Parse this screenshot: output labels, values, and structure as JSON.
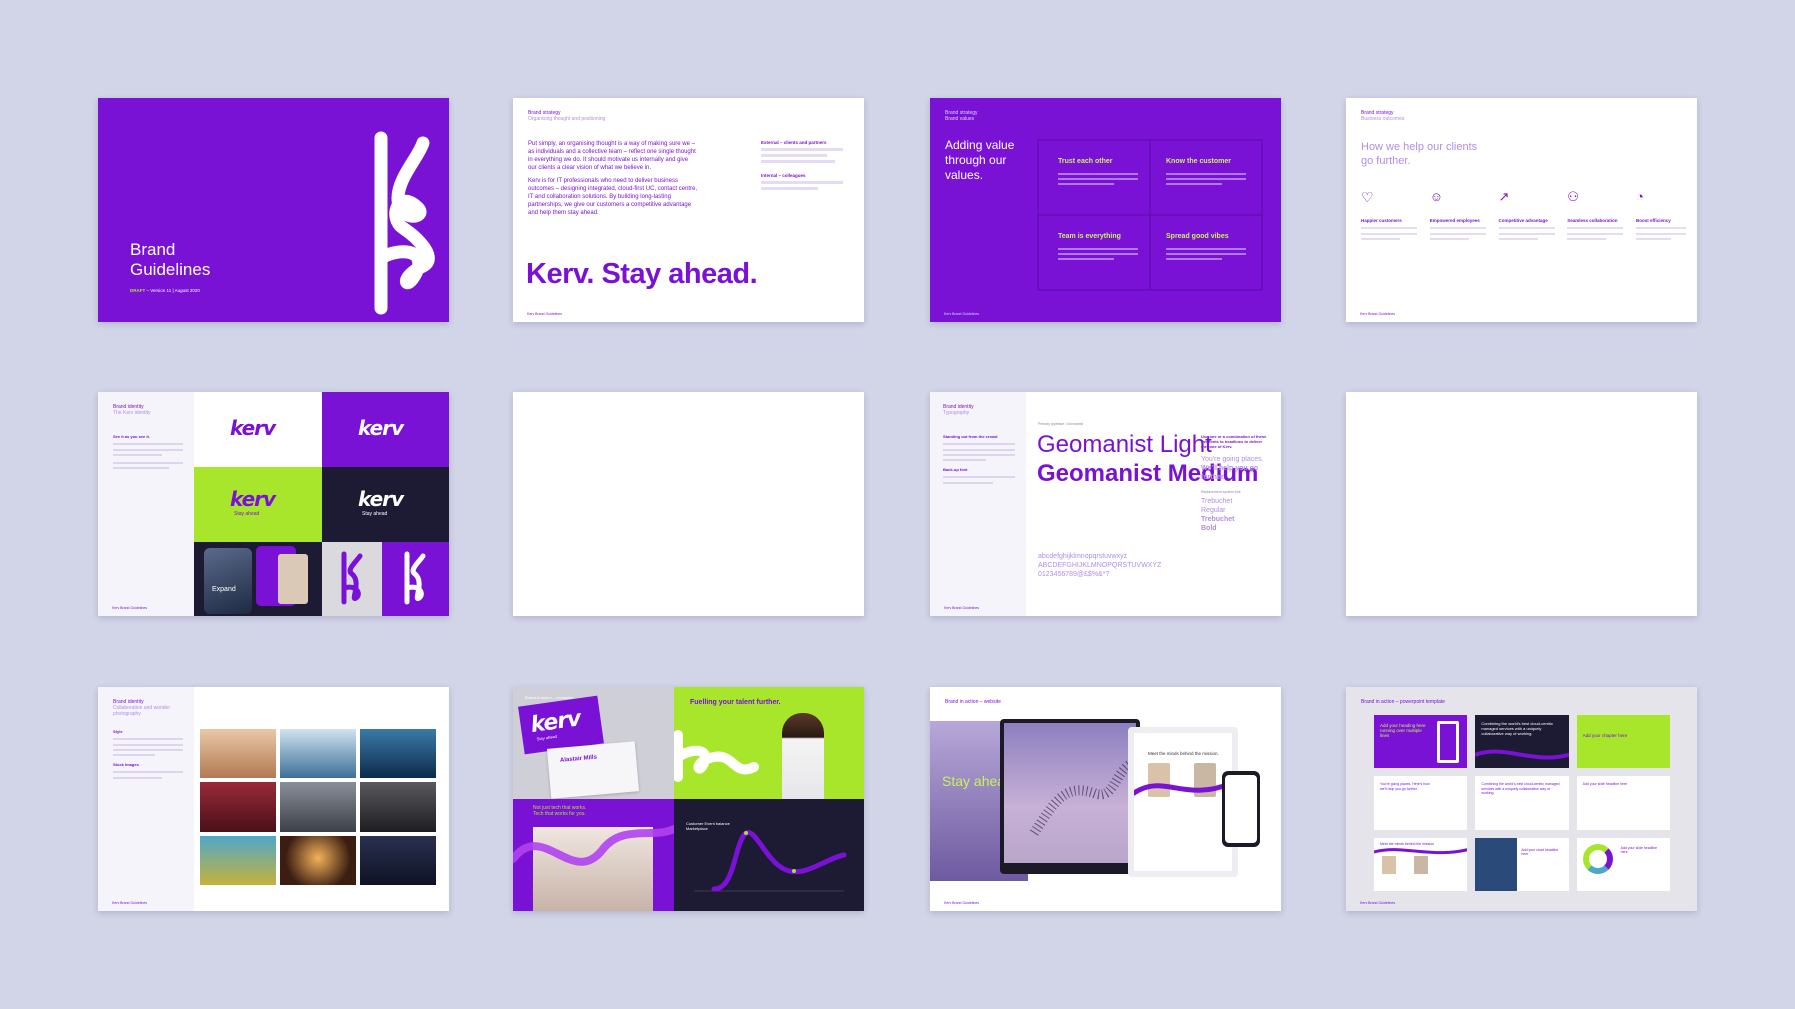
{
  "slides": {
    "cover": {
      "title_line1": "Brand",
      "title_line2": "Guidelines",
      "draft_label": "DRAFT",
      "meta": "– Version 11 | August 2020",
      "logo_text": "kerv"
    },
    "strategy": {
      "section": "Brand strategy",
      "subsection": "Organising thought and positioning",
      "body1": "Put simply, an organising thought is a way of making sure we – as individuals and a collective team – reflect one single thought in everything we do. It should motivate us internally and give our clients a clear vision of what we believe in.",
      "body2": "Kerv is for IT professionals who need to deliver business outcomes – designing integrated, cloud-first UC, contact centre, IT and collaboration solutions. By building long-lasting partnerships, we give our customers a competitive advantage and help them stay ahead.",
      "side_head1": "External – clients and partners",
      "side_head2": "Internal – colleagues",
      "headline": "Kerv. Stay ahead.",
      "footer": "Kerv Brand Guidelines"
    },
    "values": {
      "section": "Brand strategy",
      "subsection": "Brand values",
      "heading": "Adding value through our values.",
      "quads": [
        "Trust each other",
        "Know the customer",
        "Team is everything",
        "Spread good vibes"
      ],
      "footer": "Kerv Brand Guidelines"
    },
    "outcomes": {
      "section": "Brand strategy",
      "subsection": "Business outcomes",
      "heading": "How we help our clients go further.",
      "items": [
        "Happier customers",
        "Empowered employees",
        "Competitive advantage",
        "Seamless collaboration",
        "Boost efficiency"
      ],
      "footer": "Kerv Brand Guidelines"
    },
    "identity": {
      "section": "Brand identity",
      "subsection": "The Kerv identity",
      "side_head": "See it as you see it.",
      "tile_word": "kerv",
      "tagline": "Stay ahead",
      "phone_text": "Expand",
      "footer": "Kerv Brand Guidelines"
    },
    "typography": {
      "section": "Brand identity",
      "subsection": "Typography",
      "side_head1": "Standing out from the crowd",
      "side_head2": "Back-up font",
      "primary_label": "Primary typeface: Geomanist",
      "font1": "Geomanist Light",
      "font2": "Geomanist Medium",
      "glyphs1": "abcdefghijklmnopqrstuvwxyz",
      "glyphs2": "ABCDEFGHIJKLMNOPQRSTUVWXYZ",
      "glyphs3": "0123456789@£$%&*?",
      "side_callout": "Use one or a combination of these two fonts to headlines to deliver the tone of Kerv.",
      "sample1": "You're going places.",
      "sample2": "We'll help you go further.",
      "backup_label": "Replacement system font",
      "backup1": "Trebuchet",
      "backup2": "Regular",
      "backup3": "Trebuchet",
      "backup4": "Bold",
      "footer": "Kerv Brand Guidelines"
    },
    "photography": {
      "section": "Brand identity",
      "subsection": "Collaboration and wonder photography",
      "side_head1": "Style",
      "side_head2": "Stock Images",
      "footer": "Kerv Brand Guidelines"
    },
    "examples": {
      "section": "Brand in action – examples",
      "card_word": "kerv",
      "card_tag": "Stay ahead",
      "card_name": "Alastair Mills",
      "poster_head": "Fuelling your talent further.",
      "bottom_text1": "Not just tech that works.",
      "bottom_text2": "Tech that works for you.",
      "chart_label": "Customer Event balance Marketplace"
    },
    "website": {
      "section": "Brand in action – website",
      "hero": "Stay ahead.",
      "meet": "Meet the minds behind the mission.",
      "footer": "Kerv Brand Guidelines"
    },
    "powerpoint": {
      "section": "Brand in action – powerpoint template",
      "t1": "Add your heading here running over multiple lines",
      "t2": "Combining the world's best cloud-centric managed services with a uniquely collaborative way of working.",
      "t3": "Add your chapter here",
      "t4": "You're going places. Here's how we'll help you go further.",
      "t5": "Combining the world's best cloud-centric managed services with a uniquely collaborative way of working.",
      "t6": "Add your slide headline here",
      "t7": "Meet the minds behind the mission",
      "t8": "Add your chart headline here",
      "t9": "Add your slide headline here",
      "footer": "Kerv Brand Guidelines"
    }
  },
  "colors": {
    "brand_purple": "#7a12d6",
    "brand_lime": "#a8e62c",
    "brand_navy": "#1a1a3a",
    "background": "#d2d4e8"
  }
}
